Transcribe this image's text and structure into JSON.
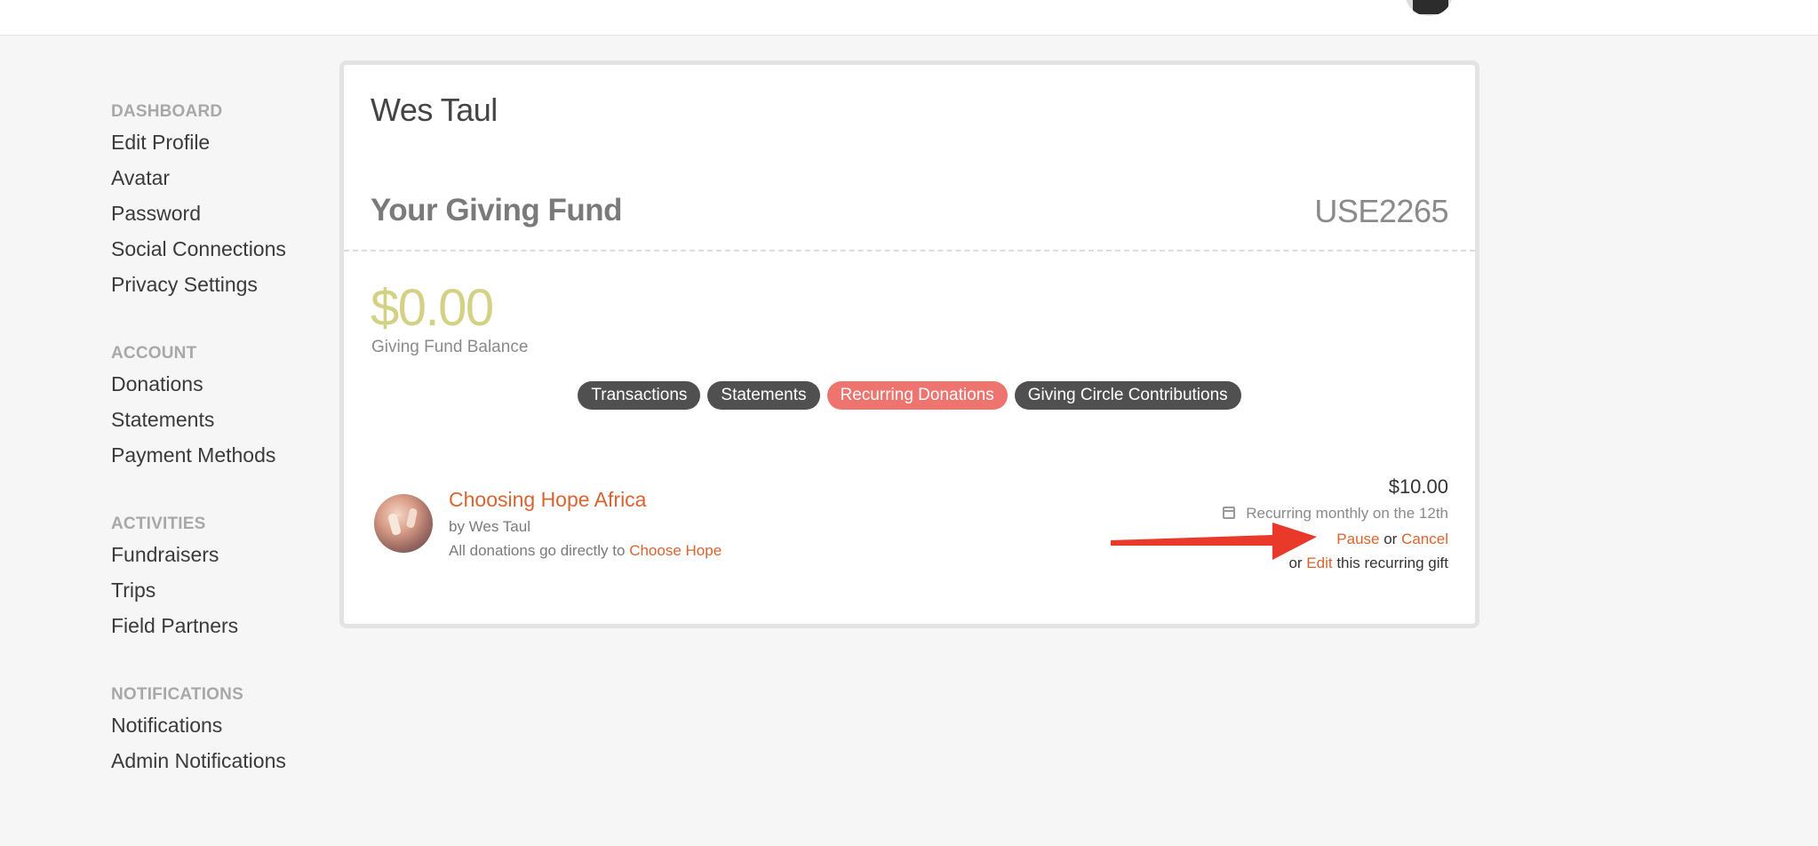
{
  "sidebar": {
    "sections": [
      {
        "heading": "DASHBOARD",
        "items": [
          "Edit Profile",
          "Avatar",
          "Password",
          "Social Connections",
          "Privacy Settings"
        ]
      },
      {
        "heading": "ACCOUNT",
        "items": [
          "Donations",
          "Statements",
          "Payment Methods"
        ]
      },
      {
        "heading": "ACTIVITIES",
        "items": [
          "Fundraisers",
          "Trips",
          "Field Partners"
        ]
      },
      {
        "heading": "NOTIFICATIONS",
        "items": [
          "Notifications",
          "Admin Notifications"
        ]
      }
    ]
  },
  "main": {
    "user_name": "Wes Taul",
    "fund_title": "Your Giving Fund",
    "fund_code": "USE2265",
    "balance_amount": "$0.00",
    "balance_label": "Giving Fund Balance",
    "tabs": [
      {
        "label": "Transactions"
      },
      {
        "label": "Statements"
      },
      {
        "label": "Recurring Donations"
      },
      {
        "label": "Giving Circle Contributions"
      }
    ],
    "active_tab": "Recurring Donations"
  },
  "donation": {
    "campaign_name": "Choosing Hope Africa",
    "by_line": "by Wes Taul",
    "note_prefix": "All donations go directly to",
    "note_link": "Choose Hope",
    "amount": "$10.00",
    "schedule": "Recurring monthly on the 12th",
    "pause_label": "Pause",
    "or_text": "or",
    "cancel_label": "Cancel",
    "edit_label": "Edit",
    "edit_suffix": "this recurring gift"
  },
  "icons": {
    "calendar": "calendar-icon",
    "annotation": "red-arrow"
  },
  "colors": {
    "link": "#d9642f",
    "active_tab": "#ee7470",
    "tab": "#505050",
    "balance": "#d3d185",
    "arrow": "#e8392a"
  }
}
